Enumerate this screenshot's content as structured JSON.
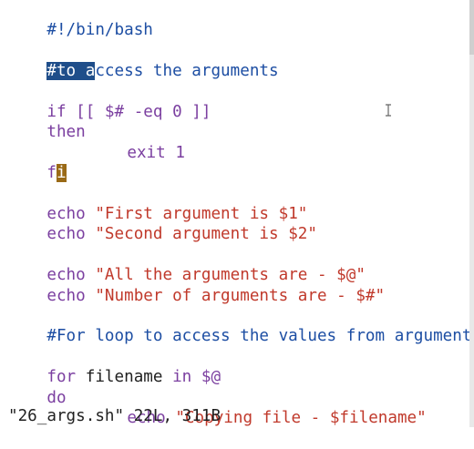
{
  "colors": {
    "comment": "#1d4ea3",
    "keyword": "#7b3fa0",
    "string": "#c0392b",
    "text": "#1f1f1f",
    "selection_bg": "#1f4e8a",
    "cursor_bg": "#9a6a16"
  },
  "editor": {
    "line1": "#!/bin/bash",
    "line2_sel": "#to a",
    "line2_rest": "ccess the arguments",
    "line3_kw": "if",
    "line3_rest": " [[ $# -eq 0 ]]",
    "line4": "then",
    "line5_kw": "exit",
    "line5_rest": " 1",
    "line6_a": "f",
    "line6_cursor": "i",
    "line7_kw": "echo",
    "line7_str": "\"First argument is $1\"",
    "line8_kw": "echo",
    "line8_str": "\"Second argument is $2\"",
    "line9_kw": "echo",
    "line9_str": "\"All the arguments are - $@\"",
    "line10_kw": "echo",
    "line10_str": "\"Number of arguments are - $#\"",
    "line11": "#For loop to access the values from arguments",
    "line12_kw1": "for",
    "line12_var": " filename ",
    "line12_kw2": "in",
    "line12_rest": " $@",
    "line13": "do",
    "line14_kw": "echo",
    "line14_str": "\"Copying file - $filename\""
  },
  "status": {
    "text": "\"26_args.sh\" 22L, 311B"
  },
  "icons": {
    "mouse": "text-ibeam-cursor-icon"
  }
}
